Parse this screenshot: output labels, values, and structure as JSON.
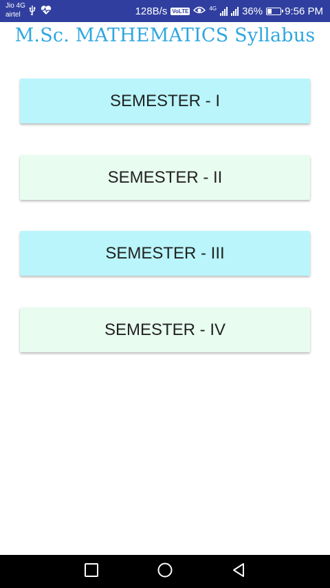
{
  "status_bar": {
    "carrier_1": "Jio 4G",
    "carrier_2": "airtel",
    "data_speed": "128B/s",
    "volte_label": "VoLTE",
    "network_label": "4G",
    "battery_percent": "36%",
    "battery_level": 0.36,
    "time": "9:56 PM",
    "icons": [
      "usb-icon",
      "heart-rate-icon",
      "volte-icon",
      "eye-icon",
      "signal-icon",
      "battery-icon"
    ]
  },
  "header": {
    "title": "M.Sc. MATHEMATICS Syllabus"
  },
  "semesters": [
    {
      "label": "SEMESTER - I"
    },
    {
      "label": "SEMESTER - II"
    },
    {
      "label": "SEMESTER - III"
    },
    {
      "label": "SEMESTER - IV"
    }
  ],
  "colors": {
    "status_bar": "#303f9f",
    "title": "#2ea6e0",
    "button_cyan": "#b9f5fb",
    "button_mint": "#e8fcf0",
    "nav_bar": "#000000"
  },
  "nav_bar": {
    "icons": [
      "recents-icon",
      "home-icon",
      "back-icon"
    ]
  }
}
